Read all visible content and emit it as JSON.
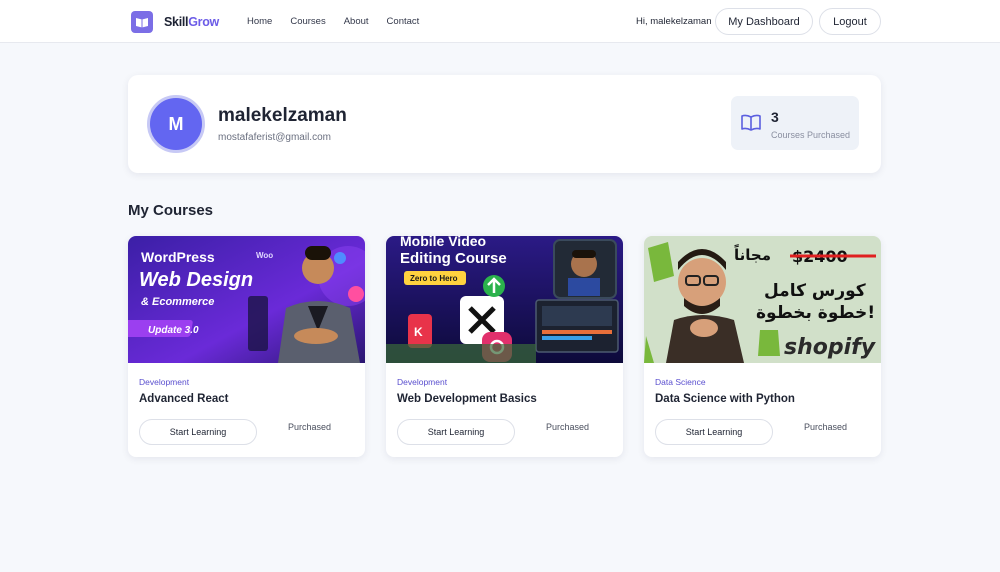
{
  "brand": {
    "name_main": "Skill",
    "name_accent": "Grow",
    "color_accent": "#6c5ce7",
    "icon": "book-logo-icon"
  },
  "nav": {
    "links": [
      "Home",
      "Courses",
      "About",
      "Contact"
    ]
  },
  "header": {
    "greeting": "Hi, malekelzaman",
    "dashboard_label": "My Dashboard",
    "logout_label": "Logout"
  },
  "profile": {
    "avatar_initial": "M",
    "name": "malekelzaman",
    "email": "mostafaferist@gmail.com",
    "stat_icon": "open-book-icon",
    "stat_count": "3",
    "stat_label": "Courses Purchased"
  },
  "section": {
    "title": "My Courses"
  },
  "courses": [
    {
      "category": "Development",
      "title": "Advanced React",
      "button": "Start Learning",
      "status": "Purchased",
      "thumb_lines": [
        "WordPress",
        "Web Design",
        "& Ecommerce",
        "Update 3.0",
        "Woo"
      ]
    },
    {
      "category": "Development",
      "title": "Web Development Basics",
      "button": "Start Learning",
      "status": "Purchased",
      "thumb_lines": [
        "Mobile Video",
        "Editing Course",
        "Zero to Hero"
      ]
    },
    {
      "category": "Data Science",
      "title": "Data Science with Python",
      "button": "Start Learning",
      "status": "Purchased",
      "thumb_lines": [
        "مجاناً",
        "$2400",
        "كورس كامل",
        "خطوة بخطوة!",
        "shopify"
      ]
    }
  ],
  "colors": {
    "page_bg": "#f6f8fc",
    "avatar": "#6366f1",
    "category": "#5a4fcf"
  }
}
